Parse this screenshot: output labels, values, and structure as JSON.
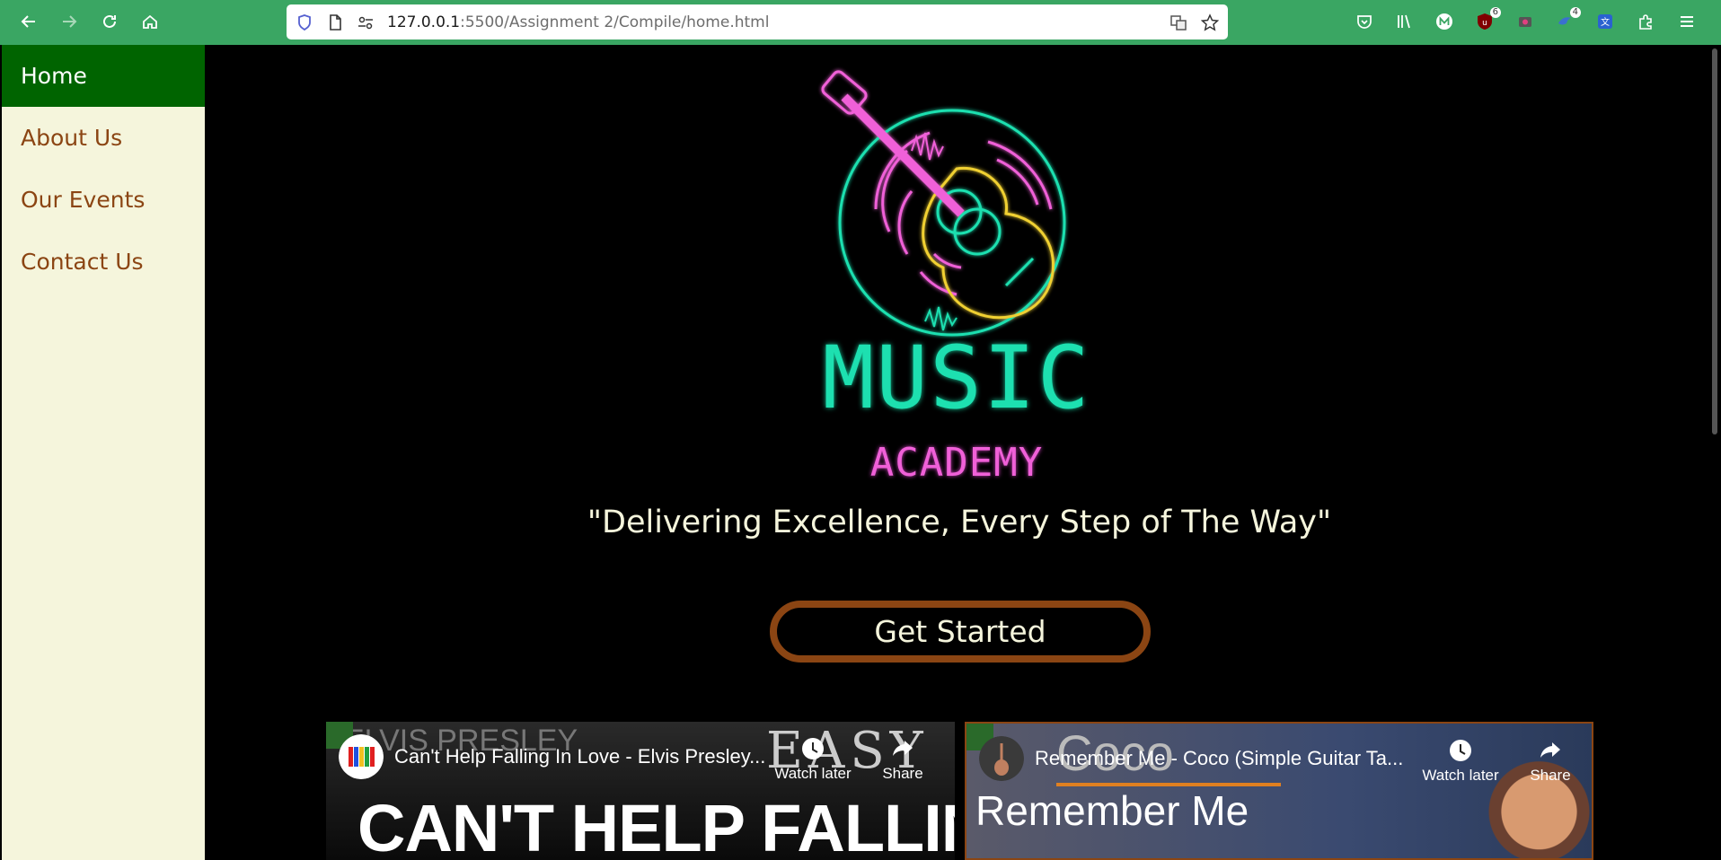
{
  "browser": {
    "url_host": "127.0.0.1",
    "url_path": ":5500/Assignment 2/Compile/home.html",
    "badges": {
      "ublock": "6",
      "ext_four": "4"
    },
    "bar_color": "#3aa663"
  },
  "sidebar": {
    "items": [
      {
        "label": "Home",
        "active": true
      },
      {
        "label": "About Us",
        "active": false
      },
      {
        "label": "Our Events",
        "active": false
      },
      {
        "label": "Contact Us",
        "active": false
      }
    ]
  },
  "hero": {
    "title": "MUSIC",
    "subtitle": "ACADEMY",
    "tagline": "\"Delivering Excellence, Every Step of The Way\"",
    "cta_label": "Get Started"
  },
  "videos": [
    {
      "title": "Can't Help Falling In Love - Elvis Presley...",
      "watch_later": "Watch later",
      "share": "Share",
      "overlay_top": "ELVIS PRESLEY",
      "overlay_side": "EASY",
      "overlay_big": "CAN'T HELP FALLING"
    },
    {
      "title": "Remember Me - Coco (Simple Guitar Ta...",
      "watch_later": "Watch later",
      "share": "Share",
      "overlay_top": "Coco",
      "overlay_big": "Remember Me"
    }
  ],
  "colors": {
    "sidebar_bg": "#f5f5dc",
    "sidebar_active": "#006400",
    "link": "#8b4513",
    "neon_teal": "#1de0b0",
    "neon_pink": "#f060d8",
    "neon_yellow": "#f0d030"
  }
}
